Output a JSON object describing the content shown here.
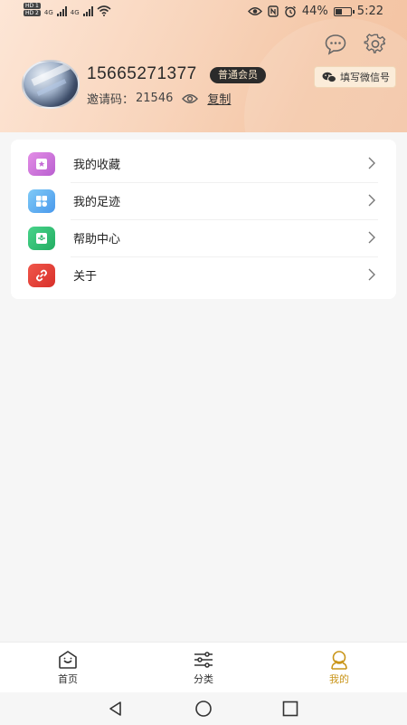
{
  "status_bar": {
    "hd_tags": [
      "HD 1",
      "HD 2"
    ],
    "network_left": "4G",
    "network_right": "4G",
    "battery_percent": "44%",
    "battery_level": 0.44,
    "time": "5:22"
  },
  "profile": {
    "phone": "15665271377",
    "member_level": "普通会员",
    "invite_label": "邀请码：",
    "invite_code": "21546",
    "copy_label": "复制",
    "wechat_button_label": "填写微信号"
  },
  "menu": {
    "items": [
      {
        "label": "我的收藏",
        "icon": "bookmark-icon",
        "color": "#c86ed6"
      },
      {
        "label": "我的足迹",
        "icon": "grid-icon",
        "color": "#5aaef0"
      },
      {
        "label": "帮助中心",
        "icon": "help-inbox-icon",
        "color": "#2fbf72"
      },
      {
        "label": "关于",
        "icon": "link-icon",
        "color": "#e3423a"
      }
    ]
  },
  "tabbar": {
    "tabs": [
      {
        "label": "首页",
        "icon": "home-icon"
      },
      {
        "label": "分类",
        "icon": "sliders-icon"
      },
      {
        "label": "我的",
        "icon": "profile-icon"
      }
    ],
    "active_color": "#c99519"
  },
  "colors": {
    "header_gradient_start": "#fde6d6",
    "header_gradient_end": "#f3c3a3",
    "badge_bg": "#2b2b2b",
    "page_bg": "#f6f6f6"
  }
}
